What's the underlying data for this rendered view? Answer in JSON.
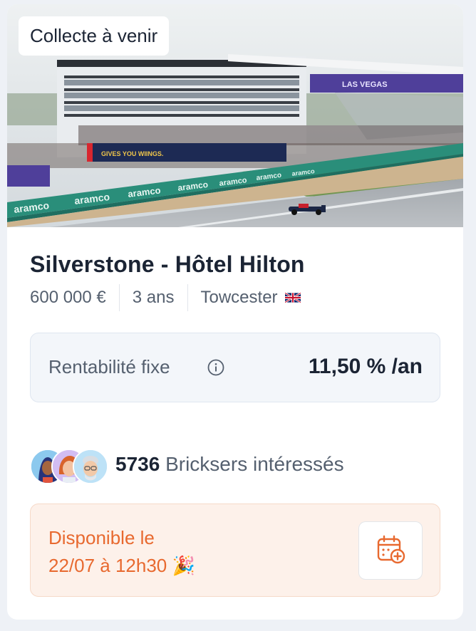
{
  "card": {
    "badge": "Collecte à venir",
    "title": "Silverstone - Hôtel Hilton",
    "amount": "600 000 €",
    "duration": "3 ans",
    "location": "Towcester",
    "country_flag": "uk-flag-icon",
    "image_texts": {
      "sponsor": "aramco",
      "banner": "LAS VEGAS",
      "slogan": "GIVES YOU WIINGS."
    }
  },
  "return": {
    "label": "Rentabilité fixe",
    "value": "11,50 % /an",
    "icon": "info-icon"
  },
  "interest": {
    "count": "5736",
    "label": "Bricksers intéressés"
  },
  "availability": {
    "line1": "Disponible le",
    "line2": "22/07 à 12h30 🎉",
    "button_icon": "calendar-add-icon"
  },
  "colors": {
    "accent": "#e8692f",
    "text_dark": "#1b2434",
    "text_muted": "#55606f",
    "page_bg": "#eef1f6",
    "return_bg": "#f3f6fa",
    "availability_bg": "#fdf1ea"
  }
}
